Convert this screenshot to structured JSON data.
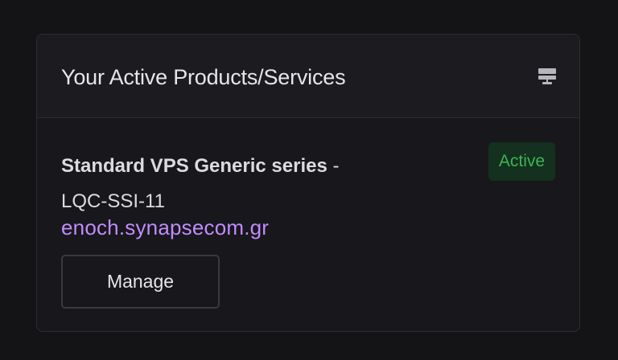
{
  "card": {
    "title": "Your Active Products/Services",
    "header_icon": "server-icon"
  },
  "product": {
    "name": "Standard VPS Generic series",
    "separator": "-",
    "id": "LQC-SSI-11",
    "domain": "enoch.synapsecom.gr",
    "status": "Active",
    "manage_label": "Manage"
  },
  "colors": {
    "background": "#141316",
    "card": "#18171b",
    "link": "#c08cff",
    "status_text": "#3cb455",
    "status_bg": "#14301e"
  }
}
